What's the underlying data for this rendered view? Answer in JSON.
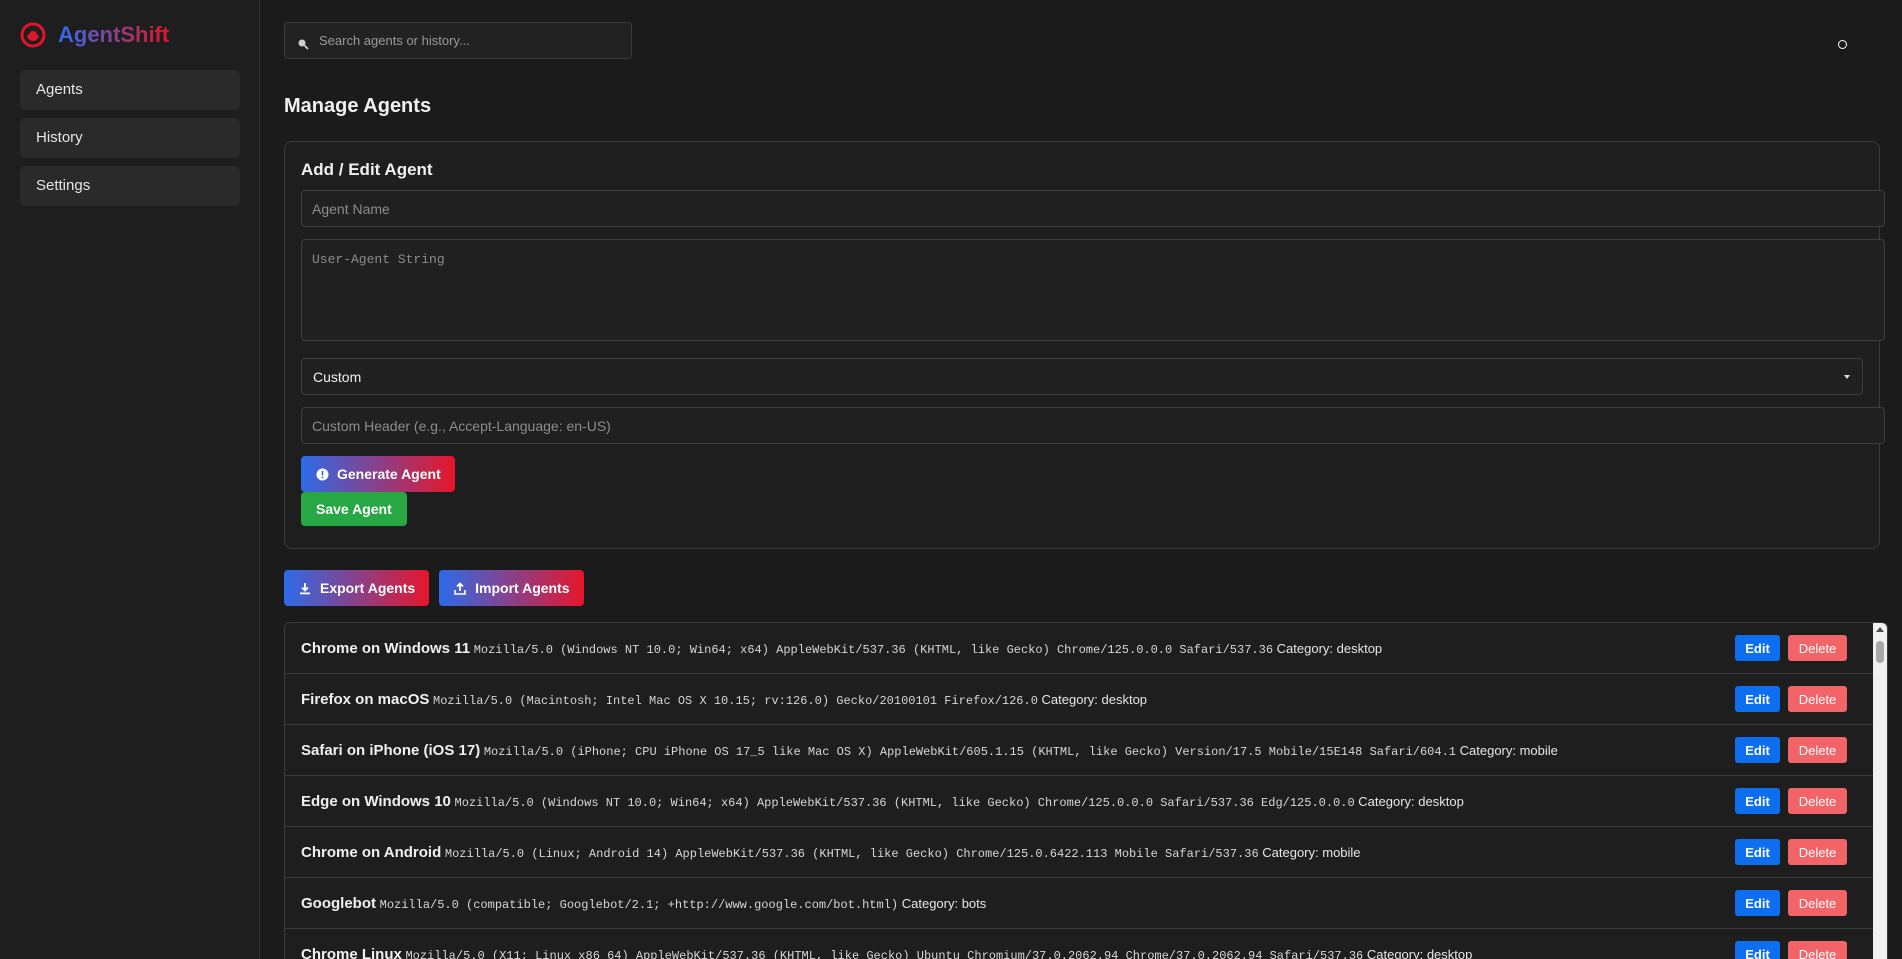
{
  "app": {
    "name": "AgentShift"
  },
  "sidebar": {
    "items": [
      {
        "label": "Agents"
      },
      {
        "label": "History"
      },
      {
        "label": "Settings"
      }
    ]
  },
  "search": {
    "placeholder": "Search agents or history..."
  },
  "page": {
    "title": "Manage Agents"
  },
  "form": {
    "title": "Add / Edit Agent",
    "name_placeholder": "Agent Name",
    "ua_placeholder": "User-Agent String",
    "category_selected": "Custom",
    "header_placeholder": "Custom Header (e.g., Accept-Language: en-US)",
    "generate_label": "Generate Agent",
    "save_label": "Save Agent"
  },
  "actions": {
    "export_label": "Export Agents",
    "import_label": "Import Agents"
  },
  "agents": [
    {
      "name": "Chrome on Windows 11",
      "ua": "Mozilla/5.0 (Windows NT 10.0; Win64; x64) AppleWebKit/537.36 (KHTML, like Gecko) Chrome/125.0.0.0 Safari/537.36",
      "category": "Category: desktop"
    },
    {
      "name": "Firefox on macOS",
      "ua": "Mozilla/5.0 (Macintosh; Intel Mac OS X 10.15; rv:126.0) Gecko/20100101 Firefox/126.0",
      "category": "Category: desktop"
    },
    {
      "name": "Safari on iPhone (iOS 17)",
      "ua": "Mozilla/5.0 (iPhone; CPU iPhone OS 17_5 like Mac OS X) AppleWebKit/605.1.15 (KHTML, like Gecko) Version/17.5 Mobile/15E148 Safari/604.1",
      "category": "Category: mobile"
    },
    {
      "name": "Edge on Windows 10",
      "ua": "Mozilla/5.0 (Windows NT 10.0; Win64; x64) AppleWebKit/537.36 (KHTML, like Gecko) Chrome/125.0.0.0 Safari/537.36 Edg/125.0.0.0",
      "category": "Category: desktop"
    },
    {
      "name": "Chrome on Android",
      "ua": "Mozilla/5.0 (Linux; Android 14) AppleWebKit/537.36 (KHTML, like Gecko) Chrome/125.0.6422.113 Mobile Safari/537.36",
      "category": "Category: mobile"
    },
    {
      "name": "Googlebot",
      "ua": "Mozilla/5.0 (compatible; Googlebot/2.1; +http://www.google.com/bot.html)",
      "category": "Category: bots"
    },
    {
      "name": "Chrome Linux",
      "ua": "Mozilla/5.0 (X11; Linux x86_64) AppleWebKit/537.36 (KHTML, like Gecko) Ubuntu Chromium/37.0.2062.94 Chrome/37.0.2062.94 Safari/537.36",
      "category": "Category: desktop"
    }
  ],
  "row_buttons": {
    "edit_label": "Edit",
    "delete_label": "Delete"
  },
  "colors": {
    "accent_blue": "#2d6be8",
    "accent_red": "#e6162a",
    "save_green": "#28a745",
    "edit_blue": "#0d6ff0",
    "delete_red": "#f26468"
  }
}
